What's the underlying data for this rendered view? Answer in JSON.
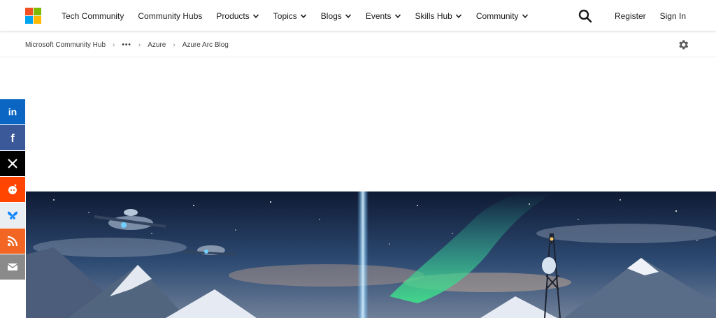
{
  "nav": {
    "items": [
      {
        "label": "Tech Community",
        "dropdown": false
      },
      {
        "label": "Community Hubs",
        "dropdown": false
      },
      {
        "label": "Products",
        "dropdown": true
      },
      {
        "label": "Topics",
        "dropdown": true
      },
      {
        "label": "Blogs",
        "dropdown": true
      },
      {
        "label": "Events",
        "dropdown": true
      },
      {
        "label": "Skills Hub",
        "dropdown": true
      },
      {
        "label": "Community",
        "dropdown": true
      }
    ],
    "register": "Register",
    "sign_in": "Sign In",
    "logo_colors": [
      "#f25022",
      "#7fba00",
      "#00a4ef",
      "#ffb900"
    ]
  },
  "breadcrumb": {
    "items": [
      "Microsoft Community Hub",
      "Azure",
      "Azure Arc Blog"
    ],
    "ellipsis": "•••"
  },
  "share": [
    {
      "name": "linkedin",
      "icon": "linkedin-icon",
      "color": "#0a66c2"
    },
    {
      "name": "facebook",
      "icon": "facebook-icon",
      "color": "#3b5998"
    },
    {
      "name": "x",
      "icon": "x-icon",
      "color": "#000000"
    },
    {
      "name": "reddit",
      "icon": "reddit-icon",
      "color": "#ff4500"
    },
    {
      "name": "bluesky",
      "icon": "bluesky-icon",
      "color": "#e8eef2"
    },
    {
      "name": "rss",
      "icon": "rss-icon",
      "color": "#f26522"
    },
    {
      "name": "email",
      "icon": "email-icon",
      "color": "#8a8a8a"
    }
  ],
  "hero": {
    "description_icon": "night-sky-drones-aurora-tower-image"
  }
}
